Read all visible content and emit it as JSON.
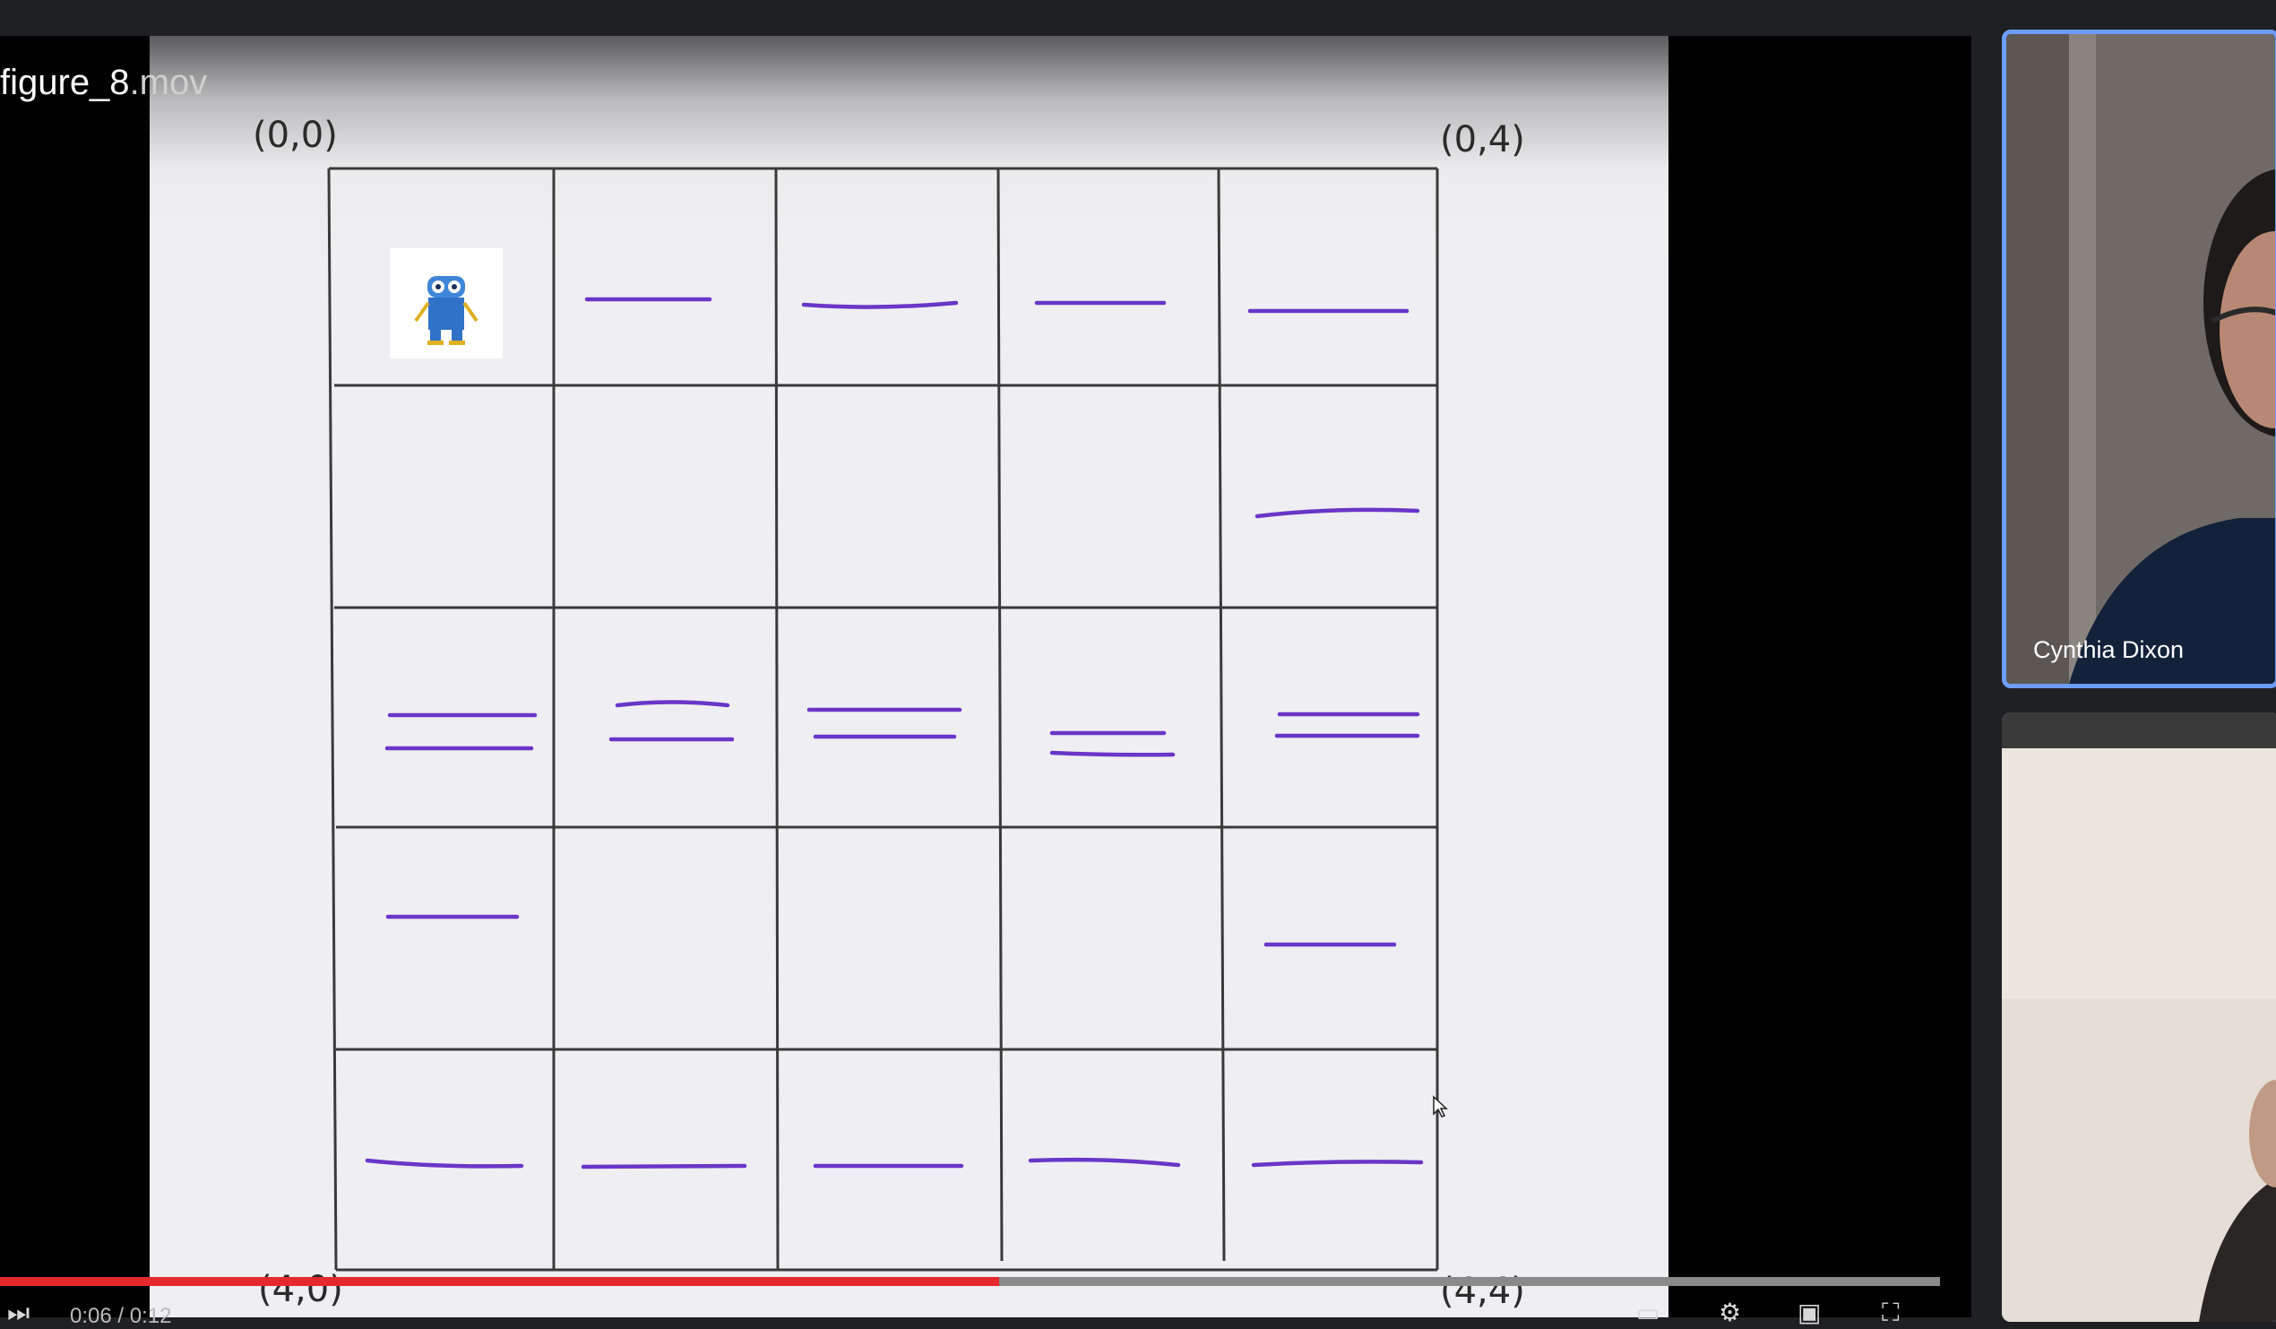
{
  "window": {
    "title": "figure_8.mov",
    "title_name": "figure_8",
    "title_ext": ".mov"
  },
  "slide": {
    "corner_labels": {
      "top_left": "(0,0)",
      "top_right": "(0,4)",
      "bottom_left": "(4,0)",
      "bottom_right": "(4,4)"
    },
    "grid": {
      "rows": 5,
      "cols": 5
    },
    "robot_cell": [
      0,
      0
    ],
    "pen_color": "#6a35c8"
  },
  "player": {
    "progress_fraction": 0.515,
    "time_display": "0:06 / 0:12",
    "progress_color": "#e5282d"
  },
  "participants": [
    {
      "name": "Cynthia Dixon",
      "active": true,
      "highlight_color": "#6d9cff"
    },
    {
      "name": "",
      "active": false
    }
  ],
  "icons": [
    "skip-icon",
    "captions-icon",
    "settings-icon",
    "miniplayer-icon",
    "fullscreen-icon",
    "cursor-icon"
  ]
}
